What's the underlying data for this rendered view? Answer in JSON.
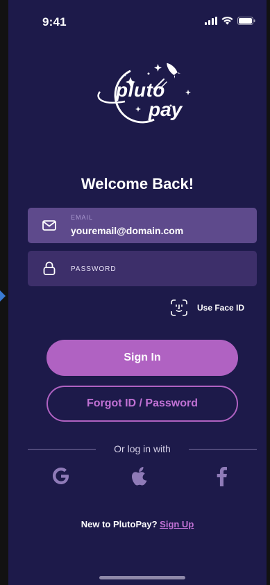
{
  "status_bar": {
    "time": "9:41"
  },
  "logo": {
    "line1": "pluto",
    "line2": "pay"
  },
  "title": "Welcome Back!",
  "email_field": {
    "label": "EMAIL",
    "value": "youremail@domain.com"
  },
  "password_field": {
    "label": "PASSWORD",
    "value": ""
  },
  "face_id": {
    "label": "Use Face ID"
  },
  "buttons": {
    "sign_in": "Sign In",
    "forgot": "Forgot ID / Password"
  },
  "social": {
    "divider_text": "Or log in with",
    "providers": [
      "google-icon",
      "apple-icon",
      "facebook-icon"
    ]
  },
  "signup": {
    "prompt": "New to PlutoPay?",
    "link": "Sign Up"
  },
  "colors": {
    "background": "#1d1a4a",
    "accent": "#b062c2",
    "email_field": "#5e4a8c",
    "password_field": "#3d2f6a"
  }
}
